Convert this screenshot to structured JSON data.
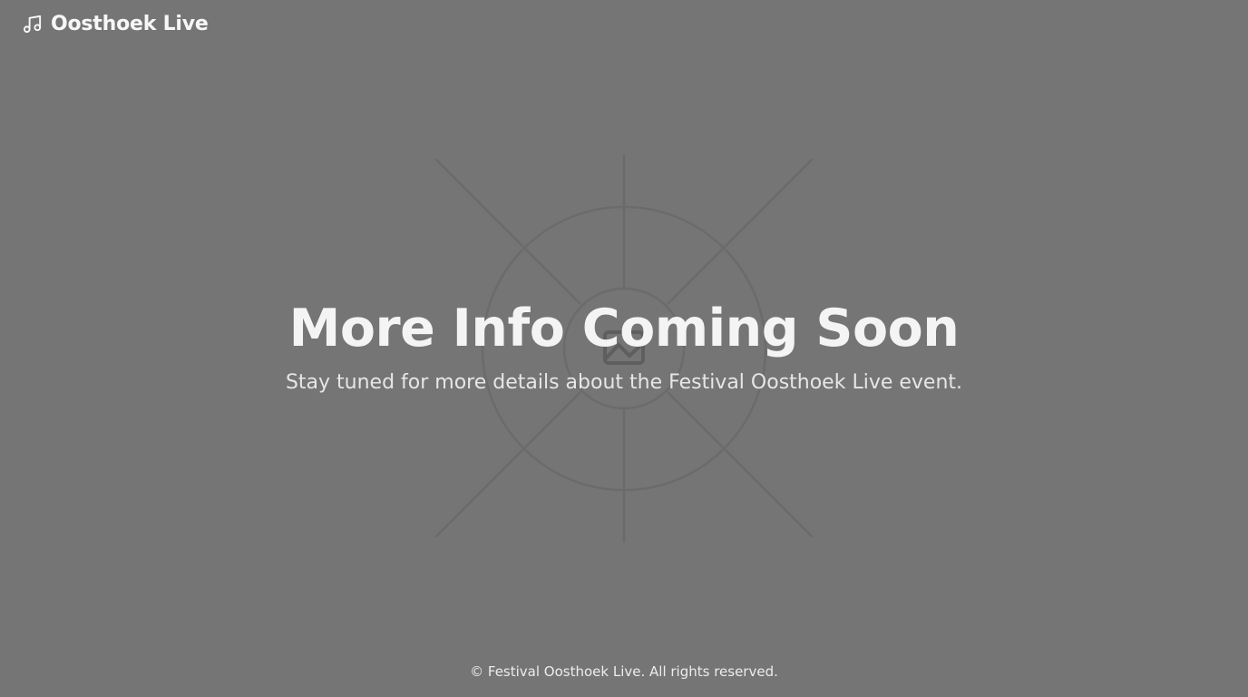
{
  "header": {
    "logo_icon": "music-note-icon",
    "brand": "Oosthoek Live"
  },
  "hero": {
    "title": "More Info Coming Soon",
    "subtitle": "Stay tuned for more details about the Festival Oosthoek Live event.",
    "background_icon": "image-placeholder-icon"
  },
  "footer": {
    "copyright": "© Festival Oosthoek Live. All rights reserved."
  },
  "colors": {
    "background": "#757575",
    "text": "#f4f4f4",
    "art_lines": "#666666"
  }
}
